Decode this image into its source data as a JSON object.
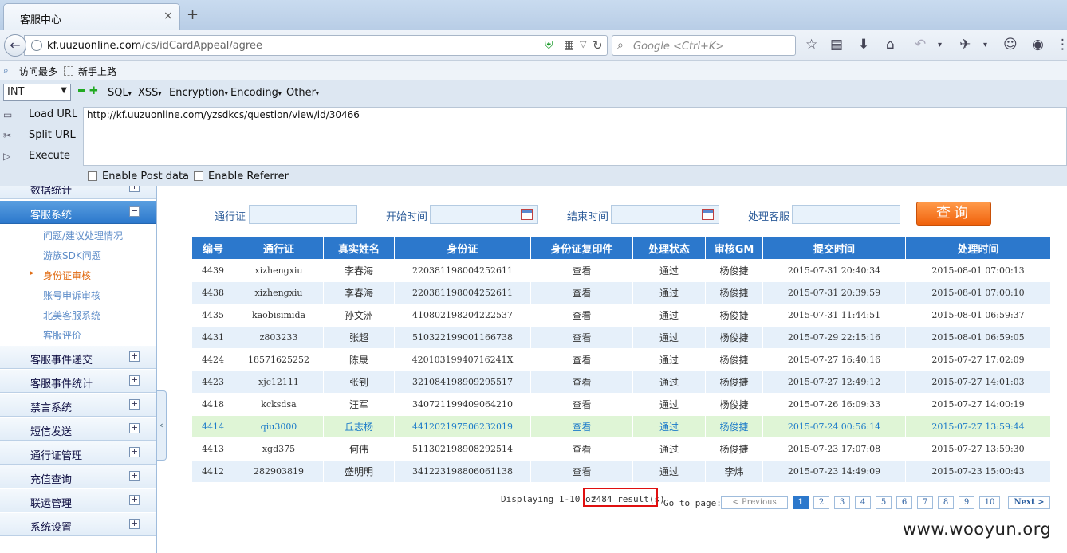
{
  "browser": {
    "tab_title": "客服中心",
    "tab_close": "×",
    "new_tab": "+",
    "url_host": "kf.uuzuonline.com",
    "url_path": "/cs/idCardAppeal/agree",
    "search_placeholder": "Google <Ctrl+K>"
  },
  "bookmarks": [
    "访问最多",
    "新手上路"
  ],
  "hackbar": {
    "select_value": "INT",
    "menus": [
      "SQL",
      "XSS",
      "Encryption",
      "Encoding",
      "Other"
    ],
    "actions": [
      "Load URL",
      "Split URL",
      "Execute"
    ],
    "url_value": "http://kf.uuzuonline.com/yzsdkcs/question/view/id/30466",
    "checks": [
      "Enable Post data",
      "Enable Referrer"
    ]
  },
  "sidebar": {
    "partial_top": "数据统计",
    "active_section": "客服系统",
    "sub_items": [
      "问题/建议处理情况",
      "游族SDK问题",
      "身份证审核",
      "账号申诉审核",
      "北美客服系统",
      "客服评价"
    ],
    "current_sub": "身份证审核",
    "sections": [
      "客服事件递交",
      "客服事件统计",
      "禁言系统",
      "短信发送",
      "通行证管理",
      "充值查询",
      "联运管理",
      "系统设置"
    ],
    "plus": "+",
    "minus": "−",
    "collapse": "‹"
  },
  "filters": {
    "account_label": "通行证",
    "start_label": "开始时间",
    "end_label": "结束时间",
    "agent_label": "处理客服",
    "query_button": "查询"
  },
  "table": {
    "headers": [
      "编号",
      "通行证",
      "真实姓名",
      "身份证",
      "身份证复印件",
      "处理状态",
      "审核GM",
      "提交时间",
      "处理时间"
    ],
    "rows": [
      [
        "4439",
        "xizhengxiu",
        "李春海",
        "220381198004252611",
        "查看",
        "通过",
        "杨俊捷",
        "2015-07-31 20:40:34",
        "2015-08-01 07:00:13"
      ],
      [
        "4438",
        "xizhengxiu",
        "李春海",
        "220381198004252611",
        "查看",
        "通过",
        "杨俊捷",
        "2015-07-31 20:39:59",
        "2015-08-01 07:00:10"
      ],
      [
        "4435",
        "kaobisimida",
        "孙文洲",
        "410802198204222537",
        "查看",
        "通过",
        "杨俊捷",
        "2015-07-31 11:44:51",
        "2015-08-01 06:59:37"
      ],
      [
        "4431",
        "z803233",
        "张超",
        "510322199001166738",
        "查看",
        "通过",
        "杨俊捷",
        "2015-07-29 22:15:16",
        "2015-08-01 06:59:05"
      ],
      [
        "4424",
        "18571625252",
        "陈晟",
        "42010319940716241X",
        "查看",
        "通过",
        "杨俊捷",
        "2015-07-27 16:40:16",
        "2015-07-27 17:02:09"
      ],
      [
        "4423",
        "xjc12111",
        "张钊",
        "321084198909295517",
        "查看",
        "通过",
        "杨俊捷",
        "2015-07-27 12:49:12",
        "2015-07-27 14:01:03"
      ],
      [
        "4418",
        "kcksdsa",
        "汪军",
        "340721199409064210",
        "查看",
        "通过",
        "杨俊捷",
        "2015-07-26 16:09:33",
        "2015-07-27 14:00:19"
      ],
      [
        "4414",
        "qiu3000",
        "丘志杨",
        "441202197506232019",
        "查看",
        "通过",
        "杨俊捷",
        "2015-07-24 00:56:14",
        "2015-07-27 13:59:44"
      ],
      [
        "4413",
        "xgd375",
        "何伟",
        "511302198908292514",
        "查看",
        "通过",
        "杨俊捷",
        "2015-07-23 17:07:08",
        "2015-07-27 13:59:30"
      ],
      [
        "4412",
        "282903819",
        "盛明明",
        "341223198806061138",
        "查看",
        "通过",
        "李炜",
        "2015-07-23 14:49:09",
        "2015-07-23 15:00:43"
      ]
    ],
    "highlighted_row": 7
  },
  "pagination": {
    "displaying": "Displaying 1-10 of",
    "result_count": "2484 result(s)",
    "goto": "Go to page:",
    "previous": "< Previous",
    "pages": [
      "1",
      "2",
      "3",
      "4",
      "5",
      "6",
      "7",
      "8",
      "9",
      "10"
    ],
    "current_page": "1",
    "next": "Next >"
  },
  "watermark": "www.wooyun.org",
  "colors": {
    "accent": "#2c78cc",
    "query_button": "#f0620c",
    "highlight_row": "#dff5d6",
    "red_box": "#e01010"
  }
}
